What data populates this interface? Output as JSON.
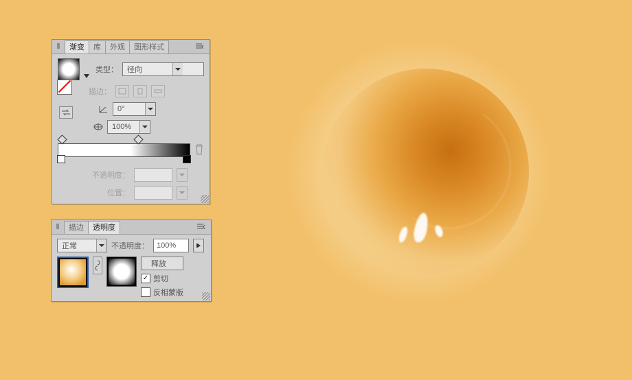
{
  "gradient_panel": {
    "tabs": [
      "渐变",
      "库",
      "外观",
      "图形样式"
    ],
    "active_tab": 0,
    "type_label": "类型：",
    "type_value": "径向",
    "stroke_label": "描边：",
    "angle_value": "0°",
    "aspect_value": "100%",
    "stops": [
      {
        "pos": 0,
        "top": true
      },
      {
        "pos": 0,
        "top": false
      },
      {
        "pos": 60,
        "top": true
      },
      {
        "pos": 100,
        "top": false
      }
    ],
    "opacity_label": "不透明度：",
    "location_label": "位置："
  },
  "transparency_panel": {
    "tabs": [
      "描边",
      "透明度"
    ],
    "active_tab": 1,
    "blend_value": "正常",
    "opacity_label": "不透明度：",
    "opacity_value": "100%",
    "release_label": "释放",
    "clip_label": "剪切",
    "clip_checked": true,
    "invert_label": "反相蒙版",
    "invert_checked": false
  }
}
